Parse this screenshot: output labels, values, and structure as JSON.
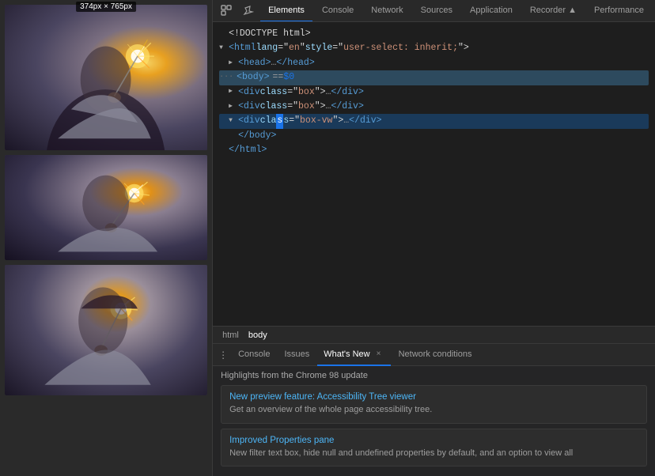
{
  "dimension_label": "374px × 765px",
  "left_panel": {
    "images": [
      {
        "id": "image-1",
        "alt": "Person holding sparkler",
        "bg_class": "sparkler-bg-1",
        "height_class": "image-card-1"
      },
      {
        "id": "image-2",
        "alt": "Person holding sparkler",
        "bg_class": "sparkler-bg-2",
        "height_class": "image-card-2"
      },
      {
        "id": "image-3",
        "alt": "Person holding sparkler",
        "bg_class": "sparkler-bg-3",
        "height_class": "image-card-3"
      }
    ]
  },
  "devtools": {
    "tabs": [
      {
        "label": "Elements",
        "active": true
      },
      {
        "label": "Console",
        "active": false
      },
      {
        "label": "Network",
        "active": false
      },
      {
        "label": "Sources",
        "active": false
      },
      {
        "label": "Application",
        "active": false
      },
      {
        "label": "Recorder ▲",
        "active": false
      },
      {
        "label": "Performance",
        "active": false
      }
    ],
    "html_lines": [
      {
        "indent": 0,
        "arrow": "none",
        "content_type": "text",
        "text": "<!DOCTYPE html>"
      },
      {
        "indent": 0,
        "arrow": "expanded",
        "content_type": "tag",
        "text": "<html lang=\"en\" style=\"user-select: inherit;\">"
      },
      {
        "indent": 1,
        "arrow": "collapsed",
        "content_type": "tag",
        "text": "▶ <head>…</head>"
      },
      {
        "indent": 0,
        "arrow": "none",
        "content_type": "special",
        "text": "··· <body> == $0"
      },
      {
        "indent": 1,
        "arrow": "collapsed",
        "content_type": "tag",
        "text": "▶ <div class=\"box\">…</div>",
        "selected": false
      },
      {
        "indent": 1,
        "arrow": "collapsed",
        "content_type": "tag",
        "text": "▶ <div class=\"box\">…</div>",
        "selected": false
      },
      {
        "indent": 1,
        "arrow": "expanded",
        "content_type": "tag",
        "text": "▼ <div class=\"box-vw\">…</div>",
        "selected": true
      },
      {
        "indent": 2,
        "arrow": "none",
        "content_type": "tag",
        "text": "</body>"
      },
      {
        "indent": 0,
        "arrow": "none",
        "content_type": "tag",
        "text": "</html>"
      }
    ],
    "breadcrumbs": [
      {
        "label": "html",
        "active": false
      },
      {
        "label": "body",
        "active": true
      }
    ],
    "bottom_tabs": [
      {
        "label": "Console",
        "closeable": false,
        "active": false
      },
      {
        "label": "Issues",
        "closeable": false,
        "active": false
      },
      {
        "label": "What's New",
        "closeable": true,
        "active": true
      },
      {
        "label": "Network conditions",
        "closeable": false,
        "active": false
      }
    ],
    "whats_new": {
      "title": "Highlights from the Chrome 98 update",
      "features": [
        {
          "id": "feature-1",
          "title": "New preview feature: Accessibility Tree viewer",
          "description": "Get an overview of the whole page accessibility tree."
        },
        {
          "id": "feature-2",
          "title": "Improved Properties pane",
          "description": "New filter text box, hide null and undefined properties by default, and an option to view all"
        }
      ]
    }
  },
  "icons": {
    "three_dots": "⋮",
    "close": "×"
  }
}
